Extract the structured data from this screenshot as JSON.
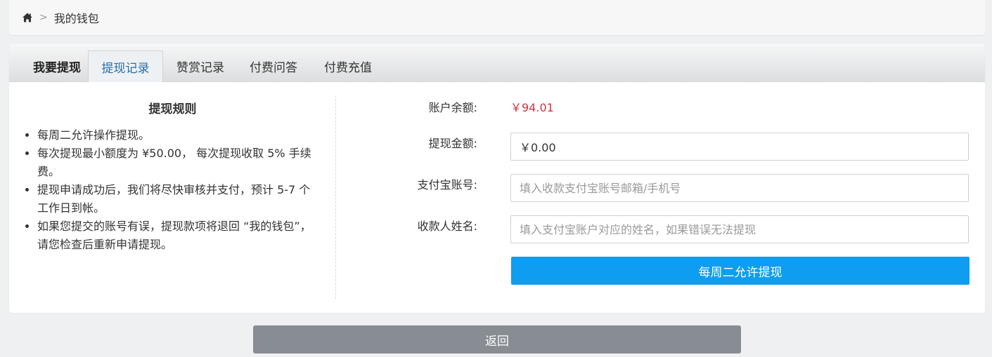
{
  "breadcrumb": {
    "home_icon": "home-icon",
    "separator": ">",
    "current": "我的钱包"
  },
  "tabs": [
    {
      "label": "我要提现"
    },
    {
      "label": "提现记录"
    },
    {
      "label": "赞赏记录"
    },
    {
      "label": "付费问答"
    },
    {
      "label": "付费充值"
    }
  ],
  "rules": {
    "title": "提现规则",
    "items": [
      "每周二允许操作提现。",
      "每次提现最小额度为 ¥50.00， 每次提现收取 5% 手续费。",
      "提现申请成功后，我们将尽快审核并支付，预计 5-7 个工作日到帐。",
      "如果您提交的账号有误，提现款项将退回 “我的钱包”，请您检查后重新申请提现。"
    ]
  },
  "form": {
    "balance_label": "账户余额:",
    "balance_value": "￥94.01",
    "amount_label": "提现金额:",
    "amount_value": "￥0.00",
    "alipay_label": "支付宝账号:",
    "alipay_placeholder": "填入收款支付宝账号邮箱/手机号",
    "name_label": "收款人姓名:",
    "name_placeholder": "填入支付宝账户对应的姓名，如果错误无法提现",
    "submit_label": "每周二允许提现"
  },
  "back_label": "返回",
  "colors": {
    "balance": "#d0343f",
    "submit_bg": "#0e9df0",
    "back_bg": "#888d93",
    "active_tab_text": "#2a6fa8"
  }
}
